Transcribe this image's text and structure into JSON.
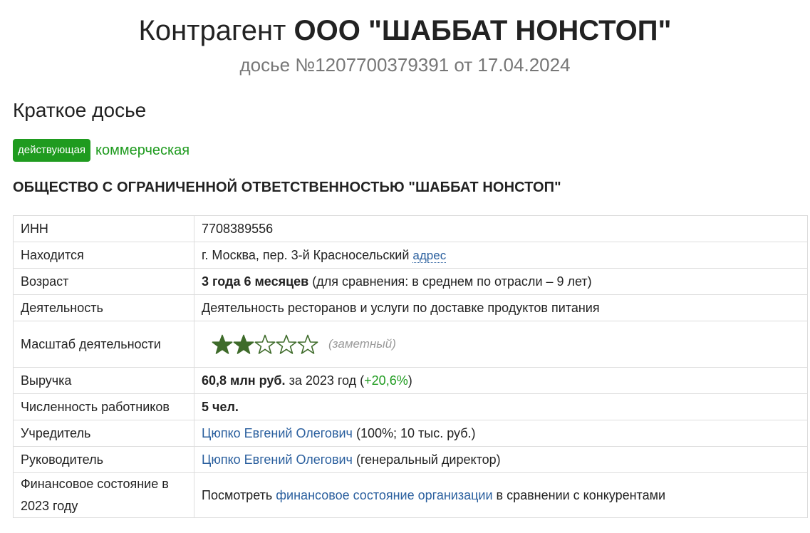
{
  "header": {
    "title_prefix": "Контрагент",
    "title_company": "ООО \"ШАББАТ НОНСТОП\"",
    "subtitle": "досье №1207700379391 от 17.04.2024"
  },
  "section_heading": "Краткое досье",
  "badges": {
    "status": "действующая",
    "type": "коммерческая"
  },
  "full_name": "ОБЩЕСТВО С ОГРАНИЧЕННОЙ ОТВЕТСТВЕННОСТЬЮ \"ШАББАТ НОНСТОП\"",
  "rows": {
    "inn": {
      "label": "ИНН",
      "value": "7708389556"
    },
    "location": {
      "label": "Находится",
      "value": "г. Москва, пер. 3-й Красносельский",
      "link": "адрес"
    },
    "age": {
      "label": "Возраст",
      "value_bold": "3 года 6 месяцев",
      "value_rest": "(для сравнения: в среднем по отрасли – 9 лет)"
    },
    "activity": {
      "label": "Деятельность",
      "value": "Деятельность ресторанов и услуги по доставке продуктов питания"
    },
    "scale": {
      "label": "Масштаб деятельности",
      "rating": 2,
      "max": 5,
      "note": "(заметный)"
    },
    "revenue": {
      "label": "Выручка",
      "value_bold": "60,8 млн руб.",
      "value_mid": "за 2023 год (",
      "change": "+20,6%",
      "value_end": ")"
    },
    "employees": {
      "label": "Численность работников",
      "value_bold": "5 чел."
    },
    "founder": {
      "label": "Учредитель",
      "link": "Цюпко Евгений Олегович",
      "value_rest": "(100%; 10 тыс. руб.)"
    },
    "director": {
      "label": "Руководитель",
      "link": "Цюпко Евгений Олегович",
      "value_rest": "(генеральный директор)"
    },
    "finance": {
      "label": "Финансовое состояние в 2023 году",
      "value_pre": "Посмотреть",
      "link": "финансовое состояние организации",
      "value_post": "в сравнении с конкурентами"
    }
  },
  "colors": {
    "accent_green": "#1f9b1f",
    "link_blue": "#2a5f9e",
    "star_fill": "#3e6b2a"
  }
}
